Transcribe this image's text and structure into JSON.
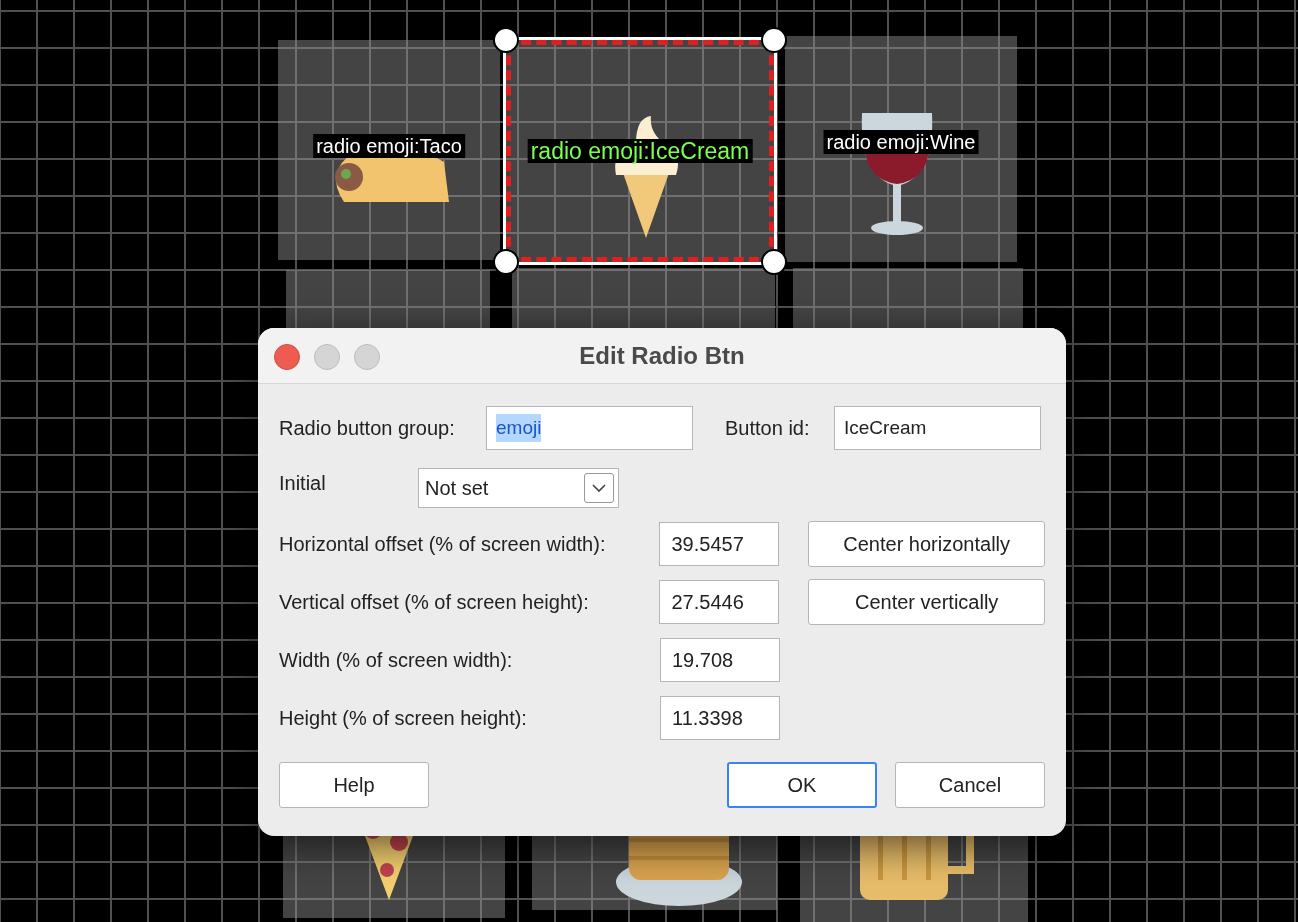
{
  "canvas": {
    "tiles": [
      {
        "label": "radio emoji:Taco",
        "selected": false,
        "kind": "taco"
      },
      {
        "label": "radio emoji:IceCream",
        "selected": true,
        "kind": "icecream"
      },
      {
        "label": "radio emoji:Wine",
        "selected": false,
        "kind": "wine"
      },
      {
        "selected": false,
        "kind": "blank"
      },
      {
        "selected": false,
        "kind": "blank"
      },
      {
        "selected": false,
        "kind": "blank"
      },
      {
        "selected": false,
        "kind": "pizza"
      },
      {
        "selected": false,
        "kind": "pancakes"
      },
      {
        "selected": false,
        "kind": "beer"
      }
    ]
  },
  "dialog": {
    "title": "Edit Radio Btn",
    "group": {
      "label": "Radio button group:",
      "value": "emoji",
      "highlighted": true
    },
    "button_id": {
      "label": "Button id:",
      "value": "IceCream",
      "highlighted": false
    },
    "initial": {
      "label": "Initial",
      "value": "Not set"
    },
    "rows": [
      {
        "label": "Horizontal offset (% of screen width):",
        "value": "39.5457",
        "action": "Center horizontally"
      },
      {
        "label": "Vertical offset (% of screen height):",
        "value": "27.5446",
        "action": "Center vertically"
      },
      {
        "label": "Width (% of screen width):",
        "value": "19.708"
      },
      {
        "label": "Height (% of screen height):",
        "value": "11.3398"
      }
    ],
    "buttons": [
      {
        "label": "Help",
        "default": false
      },
      {
        "label": "OK",
        "default": true
      },
      {
        "label": "Cancel",
        "default": false
      }
    ]
  }
}
